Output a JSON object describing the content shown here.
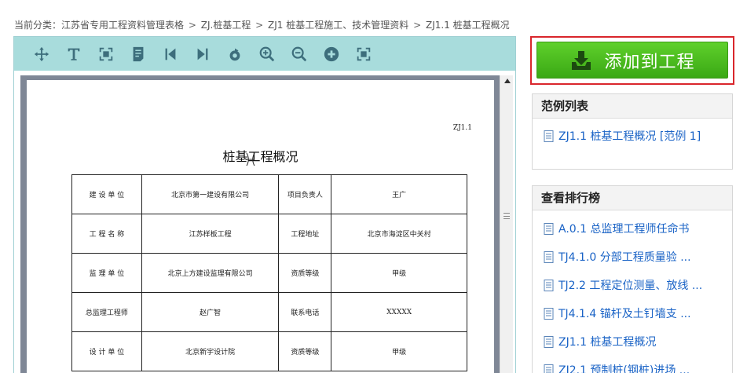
{
  "breadcrumb": {
    "prefix": "当前分类：",
    "items": [
      "江苏省专用工程资料管理表格",
      "ZJ.桩基工程",
      "ZJ1 桩基工程施工、技术管理资料",
      "ZJ1.1 桩基工程概况"
    ],
    "separator": ">"
  },
  "toolbar": {
    "icons": [
      "move-icon",
      "text-icon",
      "fit-page-icon",
      "document-icon",
      "first-page-icon",
      "last-page-icon",
      "rotate-icon",
      "zoom-in-icon",
      "zoom-out-icon",
      "add-icon",
      "fullscreen-icon"
    ]
  },
  "document": {
    "code": "ZJ1.1",
    "title": "桩基工程概况",
    "rows": [
      [
        "建 设 单 位",
        "北京市第一建设有限公司",
        "项目负责人",
        "王广"
      ],
      [
        "工 程 名 称",
        "江苏样板工程",
        "工程地址",
        "北京市海淀区中关村"
      ],
      [
        "监 理 单 位",
        "北京上方建设监理有限公司",
        "资质等级",
        "甲级"
      ],
      [
        "总监理工程师",
        "赵广智",
        "联系电话",
        "XXXXX"
      ],
      [
        "设 计 单 位",
        "北京新宇设计院",
        "资质等级",
        "甲级"
      ]
    ]
  },
  "add_button": {
    "label": "添加到工程"
  },
  "examples": {
    "title": "范例列表",
    "items": [
      "ZJ1.1 桩基工程概况  [范例  1]"
    ]
  },
  "ranking": {
    "title": "查看排行榜",
    "items": [
      "A.0.1 总监理工程师任命书",
      "TJ4.1.0 分部工程质量验  ...",
      "TJ2.2 工程定位测量、放线  ...",
      "TJ4.1.4 锚杆及土钉墙支  ...",
      "ZJ1.1 桩基工程概况",
      "ZJ2.1 预制桩(钢桩)进场  ..."
    ]
  },
  "colors": {
    "toolbar": "#a8dcdc",
    "button_green": "#4cbb1f",
    "highlight_red": "#d9262c",
    "link_blue": "#1a63c6"
  }
}
